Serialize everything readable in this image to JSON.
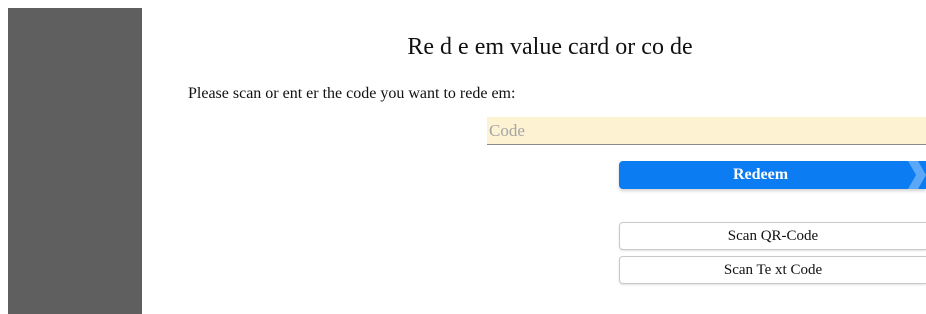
{
  "title": "Re d e em value card or co de",
  "prompt": "Please scan or ent   er the code you want   to rede em:",
  "code_input": {
    "placeholder": "Code",
    "value": ""
  },
  "buttons": {
    "redeem_label": "Redeem",
    "scan_qr_label": "Scan QR-Code",
    "scan_text_label": "Scan Te xt Code"
  },
  "colors": {
    "sidebar": "#5f5f5f",
    "accent": "#0b7cf2",
    "input_background": "#fdf2d2"
  }
}
